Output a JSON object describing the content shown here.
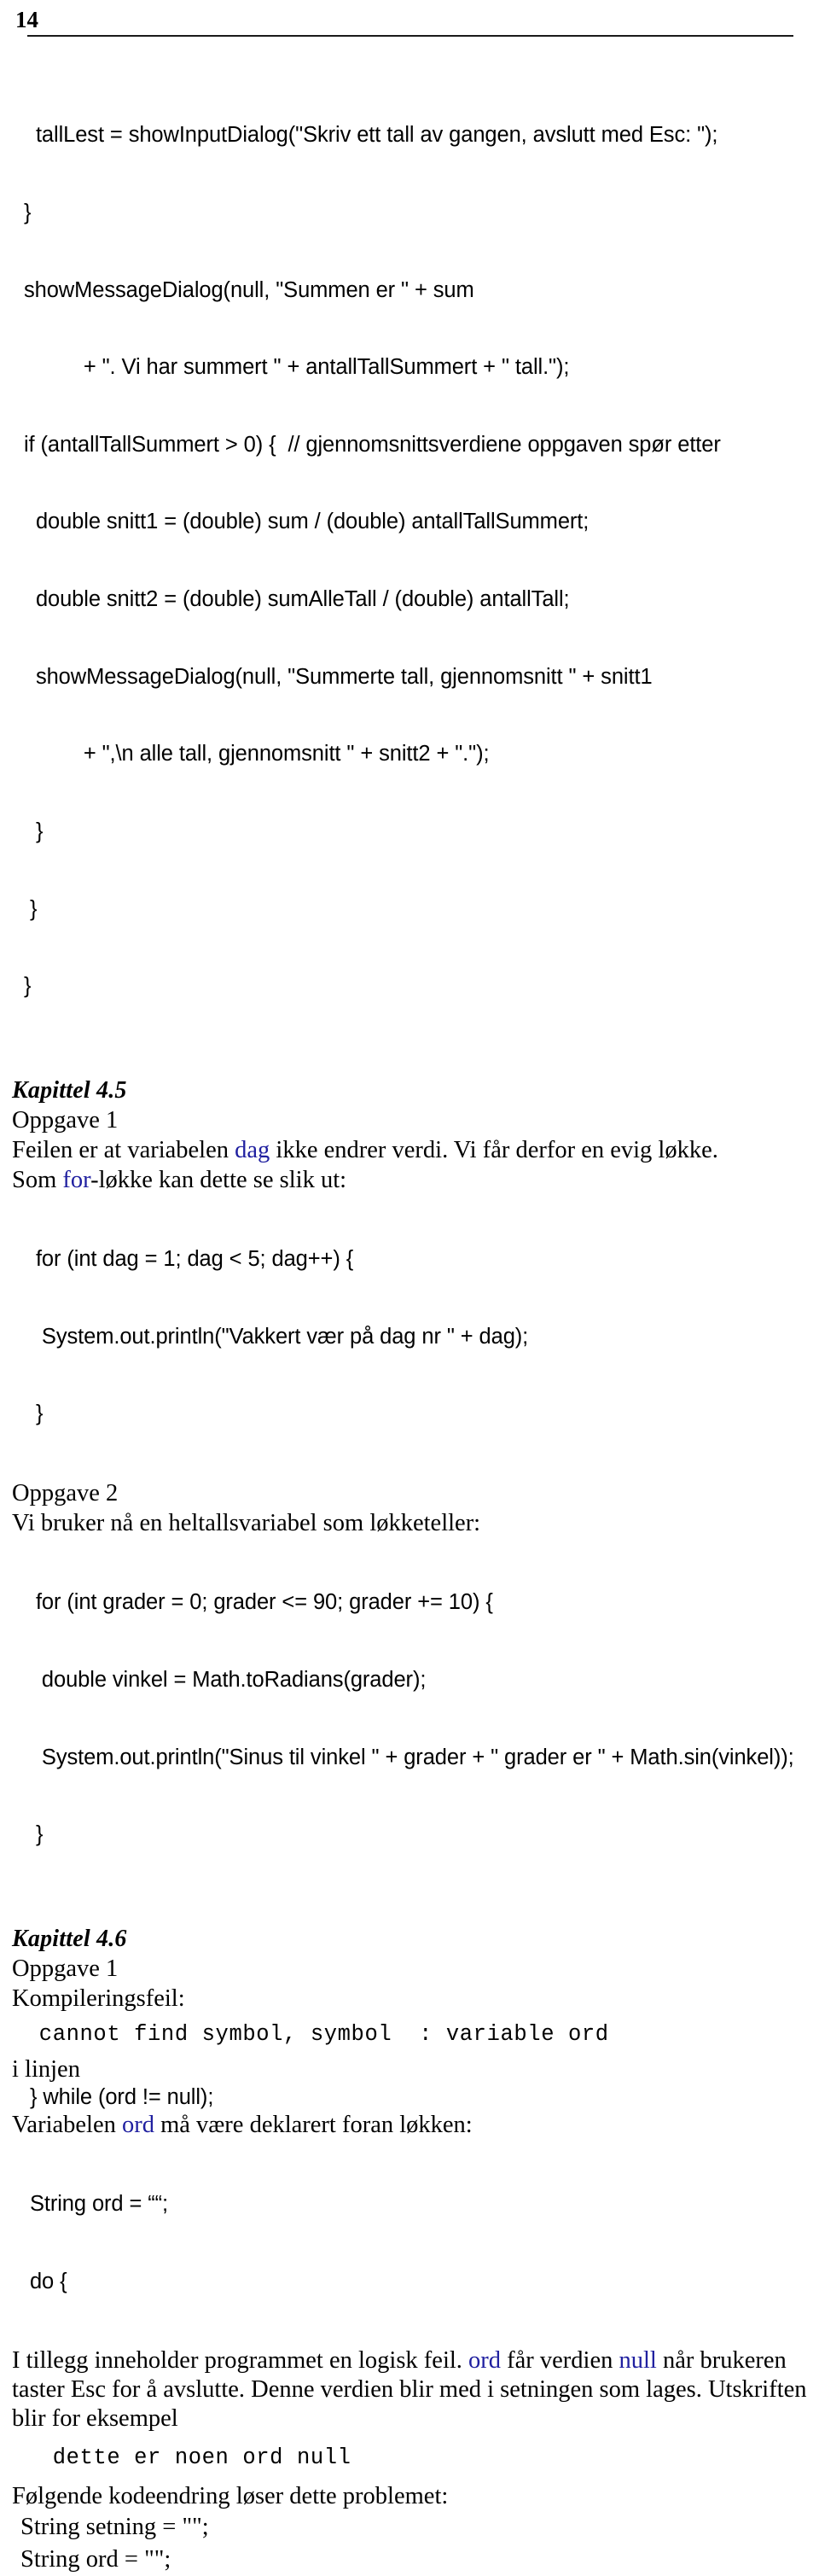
{
  "page": {
    "number": "14"
  },
  "sections": {
    "code_block_1": {
      "lines": [
        "    tallLest = showInputDialog(\"Skriv ett tall av gangen, avslutt med Esc: \");",
        "  }",
        "  showMessageDialog(null, \"Summen er \" + sum",
        "            + \". Vi har summert \" + antallTallSummert + \" tall.\");",
        "  if (antallTallSummert > 0) {  // gjennomsnittsverdiene oppgaven spør etter",
        "    double snitt1 = (double) sum / (double) antallTallSummert;",
        "    double snitt2 = (double) sumAlleTall / (double) antallTall;",
        "    showMessageDialog(null, \"Summerte tall, gjennomsnitt \" + snitt1",
        "            + \",\\n alle tall, gjennomsnitt \" + snitt2 + \".\");",
        "    }",
        "   }",
        "  }"
      ]
    },
    "kapittel_45": {
      "heading": "Kapittel 4.5",
      "oppgave_1": {
        "label": "Oppgave 1",
        "para_1_pre": "Feilen er at variabelen ",
        "para_1_kw": "dag",
        "para_1_post": " ikke endrer verdi. Vi får derfor en evig løkke.",
        "para_2_pre": "Som ",
        "para_2_kw": "for",
        "para_2_post": "-løkke kan dette se slik ut:",
        "code": [
          "    for (int dag = 1; dag < 5; dag++) {",
          "     System.out.println(\"Vakkert vær på dag nr \" + dag);",
          "    }"
        ]
      },
      "oppgave_2": {
        "label": "Oppgave 2",
        "para": "Vi bruker nå en heltallsvariabel som løkketeller:",
        "code": [
          "    for (int grader = 0; grader <= 90; grader += 10) {",
          "     double vinkel = Math.toRadians(grader);",
          "     System.out.println(\"Sinus til vinkel \" + grader + \" grader er \" + Math.sin(vinkel));",
          "    }"
        ]
      }
    },
    "kapittel_46": {
      "heading": "Kapittel 4.6",
      "oppgave_1": {
        "label": "Oppgave 1",
        "para_1": "Kompileringsfeil:",
        "compiler_error": "  cannot find symbol, symbol  : variable ord",
        "para_2": "i linjen",
        "code_1": "   } while (ord != null);",
        "para_3_pre": "Variabelen ",
        "para_3_kw": "ord",
        "para_3_post": " må være deklarert foran løkken:",
        "code_2": [
          "   String ord = ““;",
          "   do {"
        ],
        "para_4_pre": "I tillegg inneholder programmet en logisk feil. ",
        "para_4_kw1": "ord",
        "para_4_mid": " får verdien ",
        "para_4_kw2": "null",
        "para_4_post": " når brukeren taster Esc for å avslutte. Denne verdien blir med i setningen som lages. Utskriften blir for eksempel",
        "output_sample": "   dette er noen ord null",
        "para_5": "Følgende kodeendring løser dette problemet:",
        "code_3": [
          "String setning = \"\";",
          "String ord = \"\";"
        ]
      }
    }
  },
  "colors": {
    "keyword_blue": "#2020a0",
    "text_black": "#000000",
    "background": "#ffffff"
  }
}
